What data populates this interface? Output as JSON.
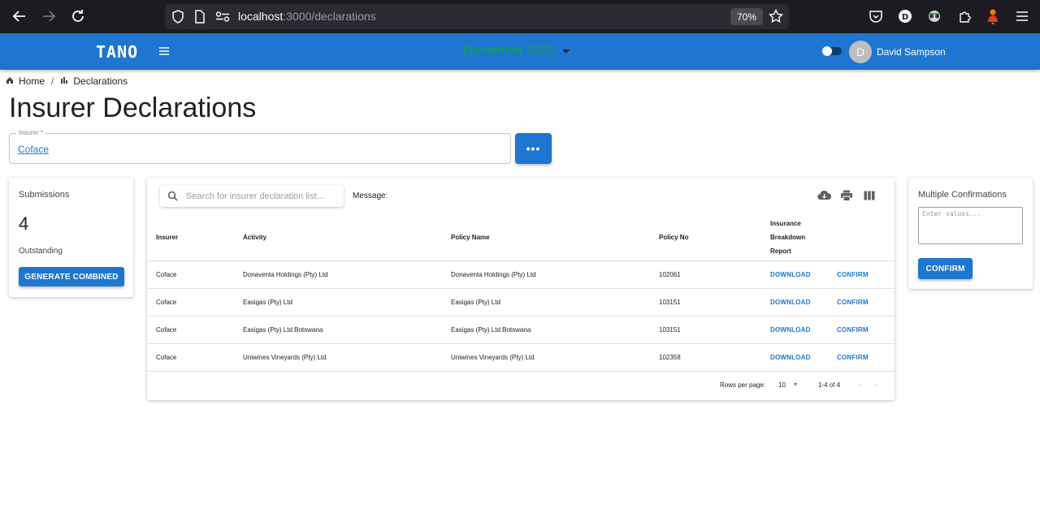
{
  "browser": {
    "url_host": "localhost",
    "url_path": ":3000/declarations",
    "zoom": "70%"
  },
  "header": {
    "brand": "TANO",
    "month": "November 2022",
    "user_initial": "D",
    "user_name": "David Sampson"
  },
  "breadcrumb": {
    "home": "Home",
    "separator": "/",
    "current": "Declarations"
  },
  "page": {
    "title": "Insurer Declarations"
  },
  "insurer": {
    "label": "Insurer *",
    "value": "Coface",
    "more_label": "•••"
  },
  "submissions": {
    "title": "Submissions",
    "count": "4",
    "status": "Outstanding",
    "button": "GENERATE COMBINED"
  },
  "table": {
    "search_placeholder": "Search for insurer declaration list...",
    "message_label": "Message:",
    "columns": {
      "insurer": "Insurer",
      "activity": "Activity",
      "policy_name": "Policy Name",
      "policy_no": "Policy No",
      "report": "Insurance Breakdown Report"
    },
    "rows": [
      {
        "insurer": "Coface",
        "activity": "Donaventa Holdings (Pty) Ltd",
        "policy_name": "Donaventa Holdings (Pty) Ltd",
        "policy_no": "102061",
        "download": "DOWNLOAD",
        "confirm": "CONFIRM"
      },
      {
        "insurer": "Coface",
        "activity": "Easigas (Pty) Ltd",
        "policy_name": "Easigas (Pty) Ltd",
        "policy_no": "103151",
        "download": "DOWNLOAD",
        "confirm": "CONFIRM"
      },
      {
        "insurer": "Coface",
        "activity": "Easigas (Pty) Ltd Botswana",
        "policy_name": "Easigas (Pty) Ltd Botswana",
        "policy_no": "103151",
        "download": "DOWNLOAD",
        "confirm": "CONFIRM"
      },
      {
        "insurer": "Coface",
        "activity": "Uniwines Vineyards (Pty) Ltd",
        "policy_name": "Uniwines Vineyards (Pty) Ltd",
        "policy_no": "102358",
        "download": "DOWNLOAD",
        "confirm": "CONFIRM"
      }
    ],
    "pagination": {
      "rows_per_page_label": "Rows per page:",
      "rows_per_page": "10",
      "range": "1-4 of 4"
    }
  },
  "confirmations": {
    "title": "Multiple Confirmations",
    "placeholder": "Enter values...",
    "button": "CONFIRM"
  },
  "colors": {
    "primary": "#1e76d0",
    "month_text": "#19a04a",
    "browser_bg": "#1c1b22"
  }
}
